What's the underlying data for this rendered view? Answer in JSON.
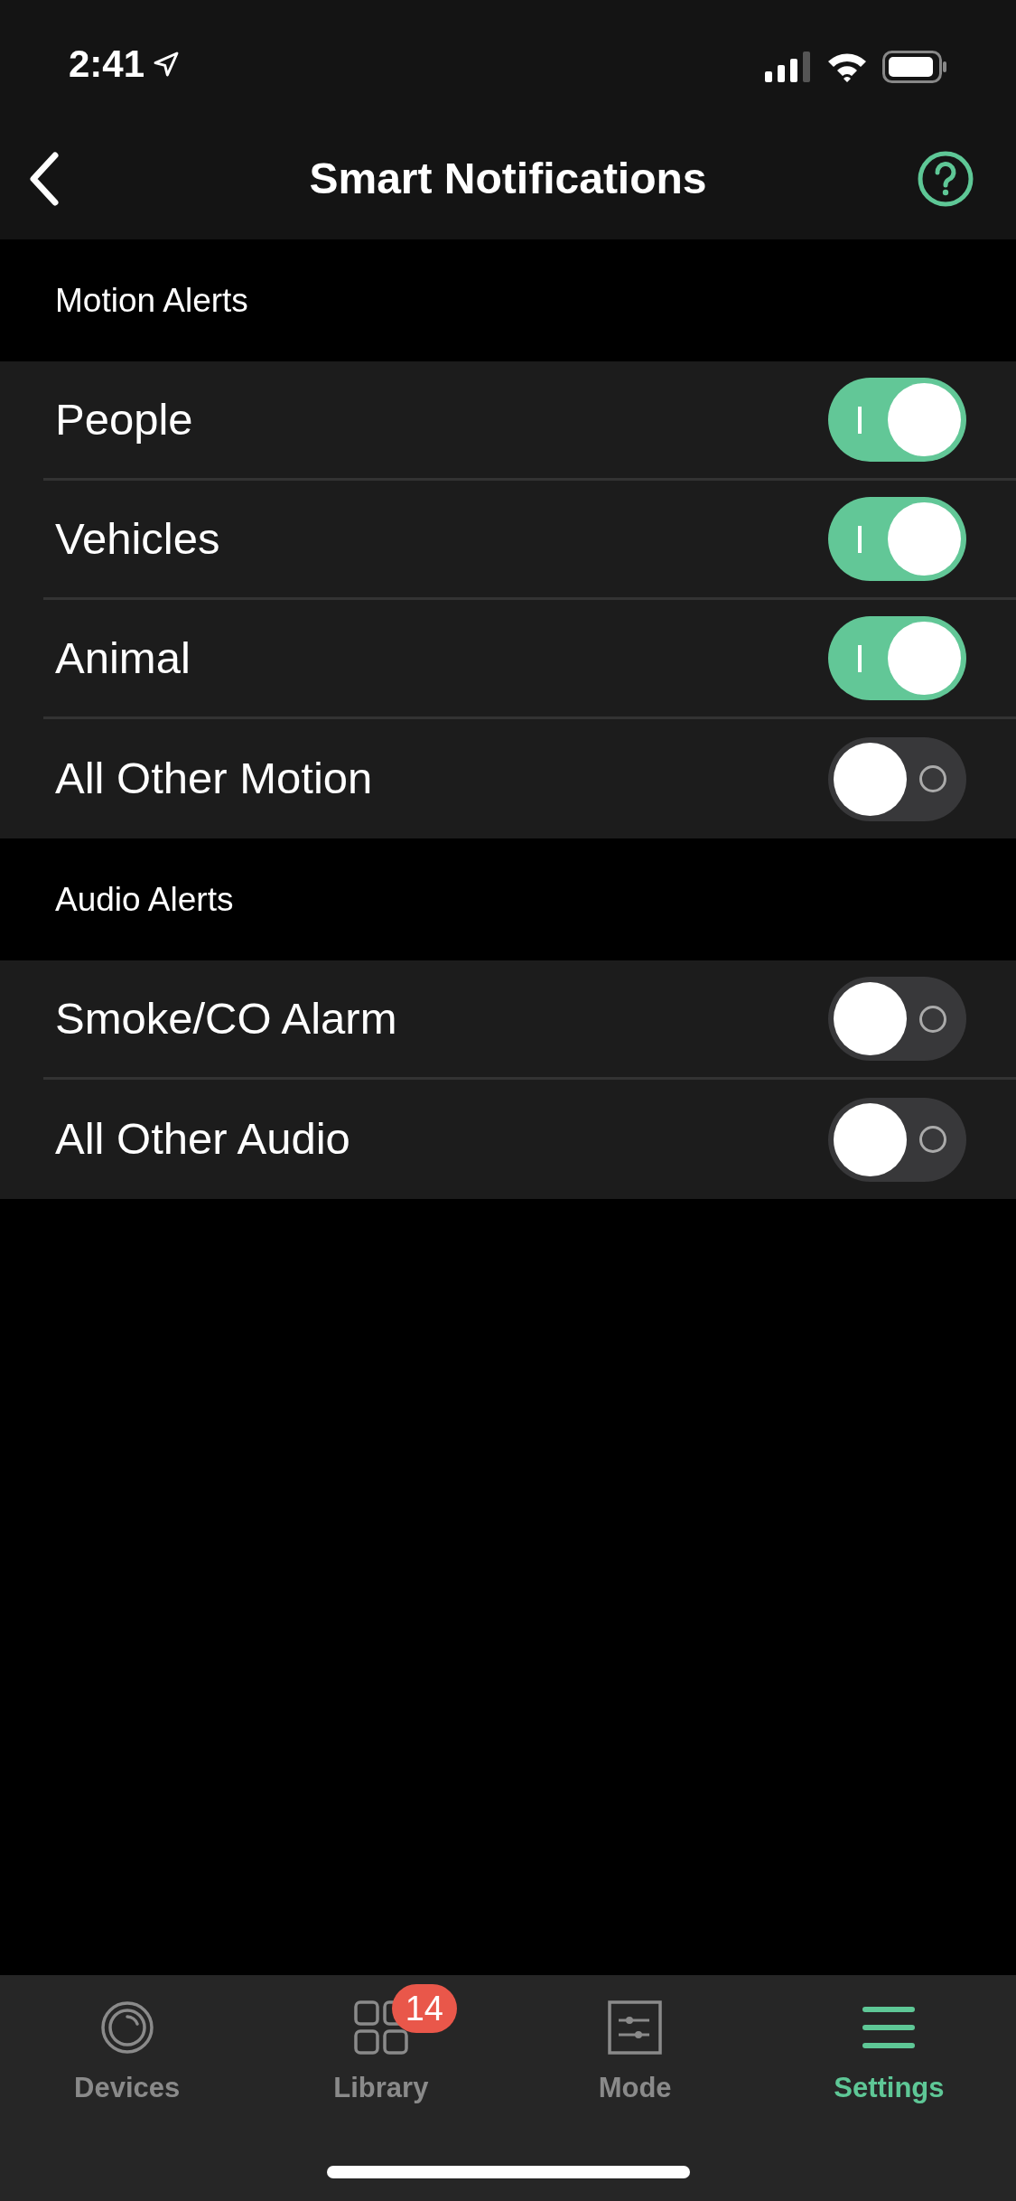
{
  "status_bar": {
    "time": "2:41"
  },
  "header": {
    "title": "Smart Notifications"
  },
  "sections": [
    {
      "title": "Motion Alerts",
      "rows": [
        {
          "label": "People",
          "on": true
        },
        {
          "label": "Vehicles",
          "on": true
        },
        {
          "label": "Animal",
          "on": true
        },
        {
          "label": "All Other Motion",
          "on": false
        }
      ]
    },
    {
      "title": "Audio Alerts",
      "rows": [
        {
          "label": "Smoke/CO Alarm",
          "on": false
        },
        {
          "label": "All Other Audio",
          "on": false
        }
      ]
    }
  ],
  "tab_bar": [
    {
      "kind": "devices",
      "label": "Devices",
      "selected": false
    },
    {
      "kind": "library",
      "label": "Library",
      "selected": false,
      "badge": "14"
    },
    {
      "kind": "mode",
      "label": "Mode",
      "selected": false
    },
    {
      "kind": "settings",
      "label": "Settings",
      "selected": true
    }
  ]
}
